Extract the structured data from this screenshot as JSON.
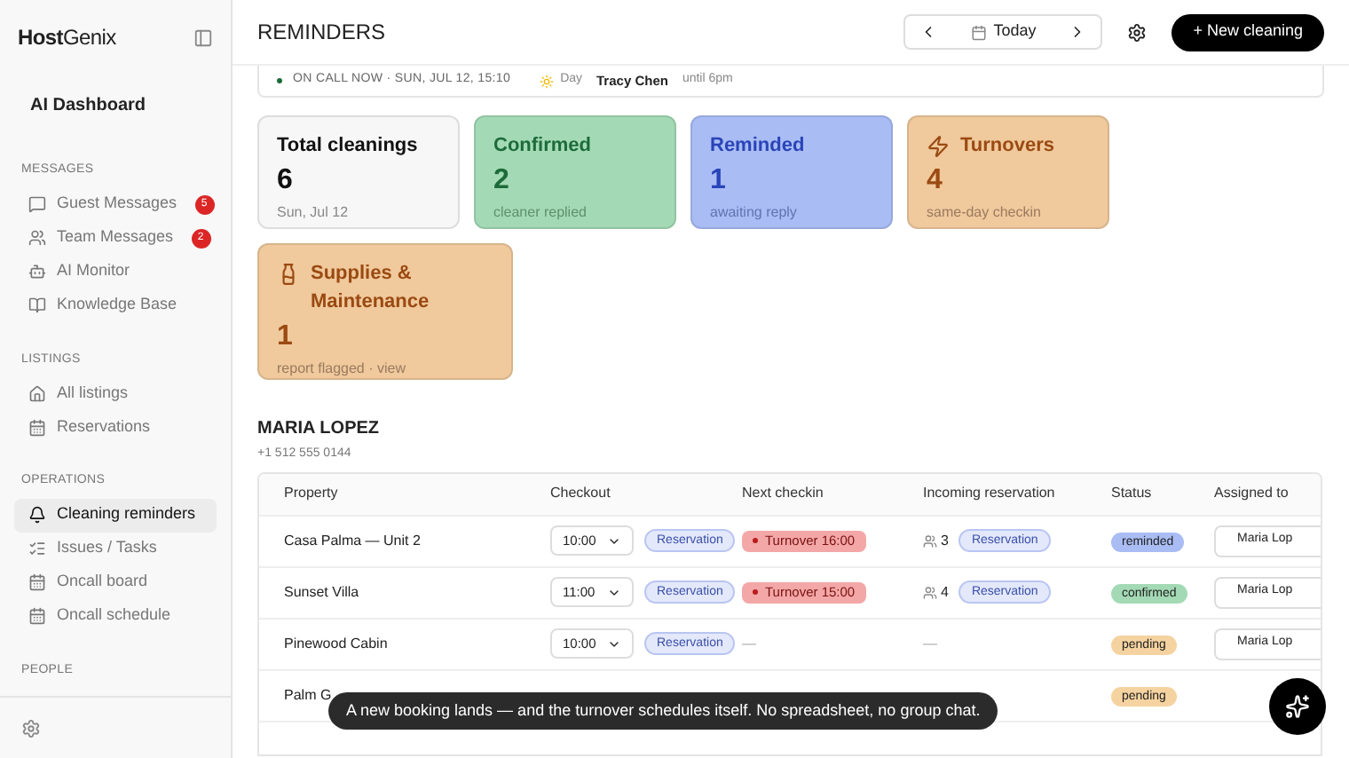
{
  "sidebar": {
    "brand_bold": "Host",
    "brand_rest": "Genix",
    "dashboard": "AI Dashboard",
    "sections": [
      {
        "title": "MESSAGES",
        "items": [
          {
            "label": "Guest Messages",
            "badge": "5",
            "selected": false
          },
          {
            "label": "Team Messages",
            "badge": "2",
            "selected": false
          },
          {
            "label": "AI Monitor",
            "selected": false
          },
          {
            "label": "Knowledge Base",
            "selected": false
          }
        ]
      },
      {
        "title": "LISTINGS",
        "items": [
          {
            "label": "All listings",
            "selected": false
          },
          {
            "label": "Reservations",
            "selected": false
          }
        ]
      },
      {
        "title": "OPERATIONS",
        "items": [
          {
            "label": "Cleaning reminders",
            "selected": true
          },
          {
            "label": "Issues / Tasks",
            "selected": false
          },
          {
            "label": "Oncall board",
            "selected": false
          },
          {
            "label": "Oncall schedule",
            "selected": false
          }
        ]
      },
      {
        "title": "PEOPLE"
      }
    ]
  },
  "header": {
    "title": "REMINDERS",
    "date": "Today",
    "new_button": "+ New cleaning"
  },
  "oncall": {
    "label": "ON CALL NOW · SUN, JUL 12, 15:10",
    "shift": "Day",
    "person": "Tracy Chen",
    "until": "until 6pm"
  },
  "cards": [
    {
      "kind": "plain",
      "title": "Total cleanings",
      "value": "6",
      "note": "Sun, Jul 12",
      "color": "#f7f7f7"
    },
    {
      "kind": "plain",
      "title": "Confirmed",
      "value": "2",
      "note": "cleaner replied",
      "color": "#a3dab5"
    },
    {
      "kind": "plain",
      "title": "Reminded",
      "value": "1",
      "note": "awaiting reply",
      "color": "#a9bcf4"
    },
    {
      "kind": "turnovers",
      "title": "Turnovers",
      "value": "4",
      "note": "same-day checkin",
      "color": "#f0c99c"
    },
    {
      "kind": "supplies",
      "title": "Supplies & Maintenance",
      "value": "1",
      "note": "report flagged · view",
      "color": "#f0c99c"
    }
  ],
  "cleaner": {
    "name": "MARIA LOPEZ",
    "phone": "+1 512 555 0144"
  },
  "table": {
    "columns": [
      "Property",
      "Checkout",
      "Next checkin",
      "Incoming reservation",
      "Status",
      "Assigned to"
    ],
    "rows": [
      {
        "property": "Casa Palma — Unit 2",
        "checkout": "10:00",
        "checkout_badge": "Reservation",
        "next": {
          "kind": "turnover",
          "text": "Turnover 16:00"
        },
        "incoming": {
          "kind": "reservation",
          "guests": "3",
          "badge": "Reservation"
        },
        "status": {
          "text": "reminded",
          "color": "#a9bcf4"
        },
        "assigned": "Maria Lop"
      },
      {
        "property": "Sunset Villa",
        "checkout": "11:00",
        "checkout_badge": "Reservation",
        "next": {
          "kind": "turnover",
          "text": "Turnover 15:00"
        },
        "incoming": {
          "kind": "reservation",
          "guests": "4",
          "badge": "Reservation"
        },
        "status": {
          "text": "confirmed",
          "color": "#a3dab5"
        },
        "assigned": "Maria Lop"
      },
      {
        "property": "Pinewood Cabin",
        "checkout": "10:00",
        "checkout_badge": "Reservation",
        "next": {
          "kind": "empty",
          "text": "—"
        },
        "incoming": {
          "kind": "empty",
          "text": "—"
        },
        "status": {
          "text": "pending",
          "color": "#f5d3a0"
        },
        "assigned": "Maria Lop"
      },
      {
        "property": "Palm G",
        "status": {
          "text": "pending",
          "color": "#f5d3a0"
        }
      }
    ]
  },
  "caption": "A new booking lands — and the turnover schedules itself. No spreadsheet, no group chat."
}
